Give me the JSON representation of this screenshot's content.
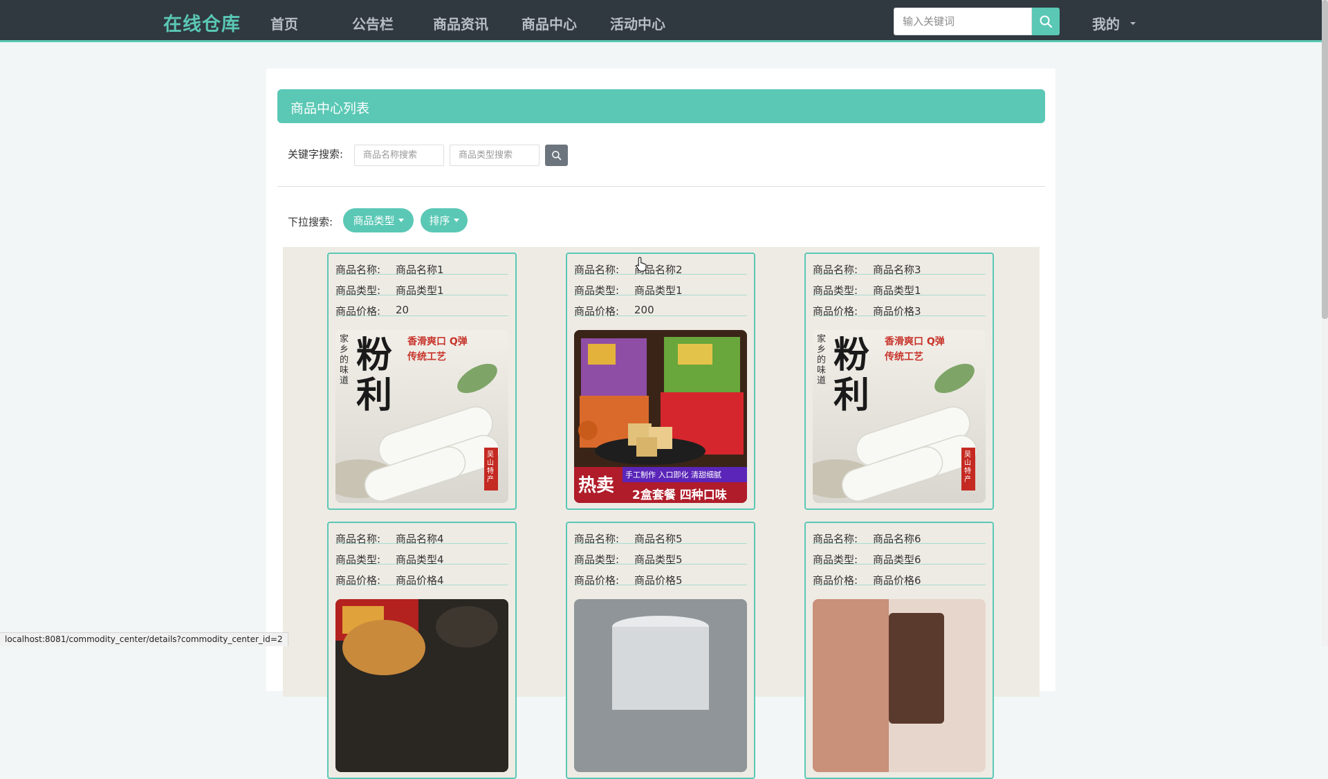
{
  "navbar": {
    "brand": "在线仓库",
    "items": [
      "首页",
      "公告栏",
      "商品资讯",
      "商品中心",
      "活动中心"
    ],
    "search_placeholder": "输入关键词",
    "mine": "我的"
  },
  "section": {
    "title": "商品中心列表"
  },
  "keyword_search": {
    "label": "关键字搜索:",
    "name_placeholder": "商品名称搜索",
    "type_placeholder": "商品类型搜索"
  },
  "dropdown_search": {
    "label": "下拉搜索:",
    "type_button": "商品类型",
    "sort_button": "排序"
  },
  "card_labels": {
    "name": "商品名称:",
    "type": "商品类型:",
    "price": "商品价格:"
  },
  "products": [
    {
      "name": "商品名称1",
      "type": "商品类型1",
      "price": "20",
      "image": "rice-cake-image"
    },
    {
      "name": "商品名称2",
      "type": "商品类型1",
      "price": "200",
      "image": "pastry-box-image"
    },
    {
      "name": "商品名称3",
      "type": "商品类型1",
      "price": "商品价格3",
      "image": "rice-cake-image"
    },
    {
      "name": "商品名称4",
      "type": "商品类型4",
      "price": "商品价格4",
      "image": "mooncake-image"
    },
    {
      "name": "商品名称5",
      "type": "商品类型5",
      "price": "商品价格5",
      "image": "cup-image"
    },
    {
      "name": "商品名称6",
      "type": "商品类型6",
      "price": "商品价格6",
      "image": "cosmetic-image"
    }
  ],
  "image_texts": {
    "rice_cake": {
      "main": "粉利",
      "side": "家乡的味道",
      "slogan1": "香滑爽口 Q弹",
      "slogan2": "传统工艺",
      "seal": "吴山特产"
    },
    "pastry": {
      "hot": "热卖",
      "banner1": "手工制作 入口即化 清甜细腻",
      "banner2": "2盒套餐 四种口味"
    }
  },
  "status_url": "localhost:8081/commodity_center/details?commodity_center_id=2",
  "colors": {
    "accent": "#5ac8b5",
    "navbar": "#303840",
    "grid_bg": "#eeebe4"
  }
}
